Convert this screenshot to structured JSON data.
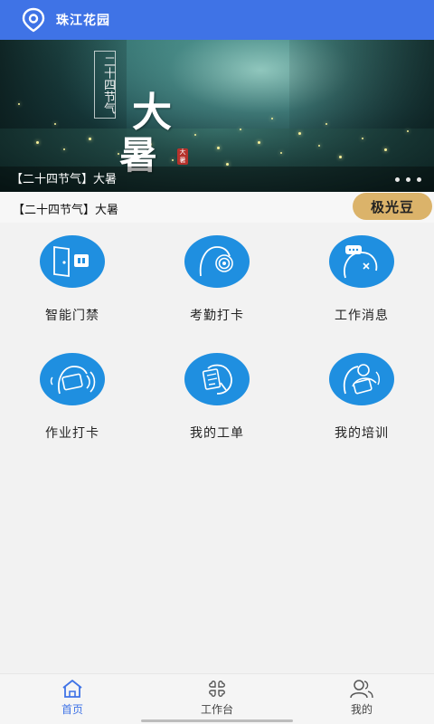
{
  "header": {
    "title": "珠江花园",
    "icon": "location-pin-icon",
    "color": "#3f73e6"
  },
  "banner": {
    "vertical_text": "二十四节气",
    "big_text_1": "大",
    "big_text_2": "暑",
    "seal_text": "大暑",
    "caption": "【二十四节气】大暑",
    "page_count": 3
  },
  "subtitle": {
    "text": "【二十四节气】大暑",
    "coin_button": "极光豆",
    "coin_color": "#dbb36a"
  },
  "grid": {
    "items": [
      {
        "label": "智能门禁",
        "icon": "door-access-icon"
      },
      {
        "label": "考勤打卡",
        "icon": "fingerprint-icon"
      },
      {
        "label": "工作消息",
        "icon": "message-icon"
      },
      {
        "label": "作业打卡",
        "icon": "nfc-card-icon"
      },
      {
        "label": "我的工单",
        "icon": "work-order-icon"
      },
      {
        "label": "我的培训",
        "icon": "training-icon"
      }
    ],
    "icon_color": "#1f8fe0"
  },
  "bottom_nav": {
    "tabs": [
      {
        "label": "首页",
        "icon": "home-icon",
        "active": true
      },
      {
        "label": "工作台",
        "icon": "workbench-icon",
        "active": false
      },
      {
        "label": "我的",
        "icon": "profile-icon",
        "active": false
      }
    ]
  }
}
